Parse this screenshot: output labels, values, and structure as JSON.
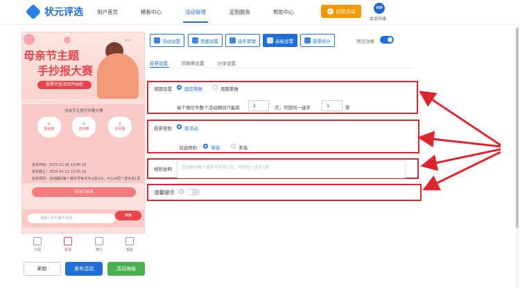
{
  "brand": {
    "name": "状元评选"
  },
  "nav": [
    {
      "label": "用户首页"
    },
    {
      "label": "模板中心"
    },
    {
      "label": "活动管理"
    },
    {
      "label": "定制服务"
    },
    {
      "label": "帮助中心"
    }
  ],
  "header": {
    "create_label": "创建活动",
    "vip_badge": "VIP",
    "vip_label": "会员升级"
  },
  "phone": {
    "poster_title_1": "母亲节主题",
    "poster_title_2": "手抄报大赛",
    "poster_sub": "投票评选活动开始啦",
    "card_title": "母亲节主题手抄报大赛",
    "stats": [
      {
        "value": "0",
        "label": "报名数"
      },
      {
        "value": "0",
        "label": "选手数"
      },
      {
        "value": "0",
        "label": "访问量"
      }
    ],
    "info_lines": [
      "投票开始：2025-01-16 13:45:18",
      "投票截止：2025-01-22 13:45:18",
      "投票规则：活动期间每个微信号每天可以投1次，可以对同一选手投1票"
    ],
    "vote_button": "活动已结束",
    "search_placeholder": "请输入选手编号/名称",
    "search_button": "搜索",
    "tabbar": [
      {
        "label": "介绍"
      },
      {
        "label": "投票"
      },
      {
        "label": "排行"
      },
      {
        "label": "报名"
      }
    ]
  },
  "bottom_buttons": {
    "refresh": "刷新",
    "publish": "发布活动",
    "poster": "活动海报"
  },
  "settings_tabs": [
    {
      "label": "活动设置"
    },
    {
      "label": "页面设置"
    },
    {
      "label": "选手管理"
    },
    {
      "label": "高级设置"
    },
    {
      "label": "投票统计"
    }
  ],
  "preview": {
    "label": "预览效果",
    "on": true
  },
  "sub_tabs": [
    {
      "label": "投票设置"
    },
    {
      "label": "防刷票设置"
    },
    {
      "label": "分享设置"
    }
  ],
  "cycle": {
    "label": "周期设置",
    "option_fixed": "固定票数",
    "option_cycle": "周期票数",
    "text_before": "每个微信号整个活动期间只能投",
    "times_value": "1",
    "text_mid": "次，可投同一选手",
    "votes_value": "1",
    "text_after": "票"
  },
  "rule": {
    "label": "投票规则",
    "option_by_activity": "按活动",
    "check_rule_label": "勾选规则",
    "option_single": "单选",
    "option_multi": "多选"
  },
  "rule_desc": {
    "label": "规则说明",
    "placeholder": "活动期间每个微信号可投1次，可投同一选手1票"
  },
  "tips": {
    "label": "温馨提示",
    "help": "?"
  },
  "colors": {
    "accent": "#1f6fd6",
    "highlight_box": "#e0242f",
    "create_button": "#f39800"
  }
}
